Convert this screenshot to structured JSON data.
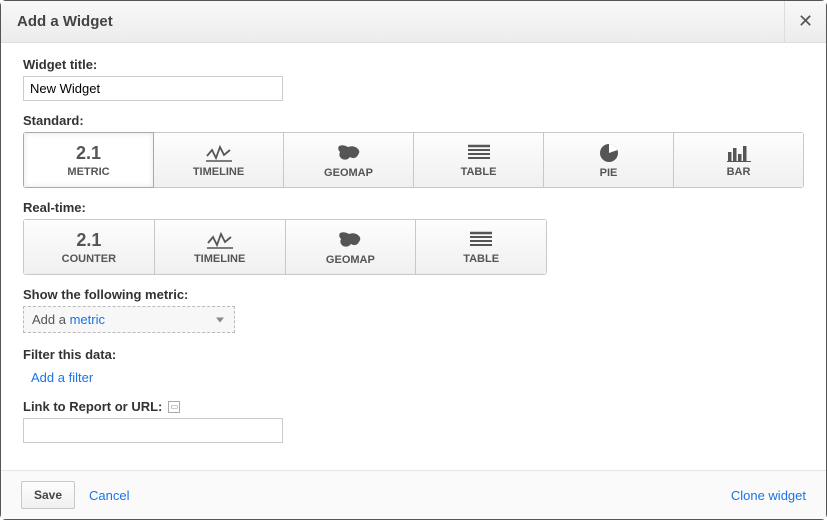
{
  "dialog": {
    "title": "Add a Widget"
  },
  "widget_title": {
    "label": "Widget title:",
    "value": "New Widget"
  },
  "standard": {
    "label": "Standard:",
    "types": [
      {
        "label": "METRIC",
        "icon_text": "2.1"
      },
      {
        "label": "TIMELINE"
      },
      {
        "label": "GEOMAP"
      },
      {
        "label": "TABLE"
      },
      {
        "label": "PIE"
      },
      {
        "label": "BAR"
      }
    ]
  },
  "realtime": {
    "label": "Real-time:",
    "types": [
      {
        "label": "COUNTER",
        "icon_text": "2.1"
      },
      {
        "label": "TIMELINE"
      },
      {
        "label": "GEOMAP"
      },
      {
        "label": "TABLE"
      }
    ]
  },
  "metric_section": {
    "label": "Show the following metric:",
    "dropdown_prefix": "Add a ",
    "dropdown_link": "metric"
  },
  "filter_section": {
    "label": "Filter this data:",
    "add_link": "Add a filter"
  },
  "link_section": {
    "label": "Link to Report or URL:",
    "value": ""
  },
  "footer": {
    "save": "Save",
    "cancel": "Cancel",
    "clone": "Clone widget"
  }
}
